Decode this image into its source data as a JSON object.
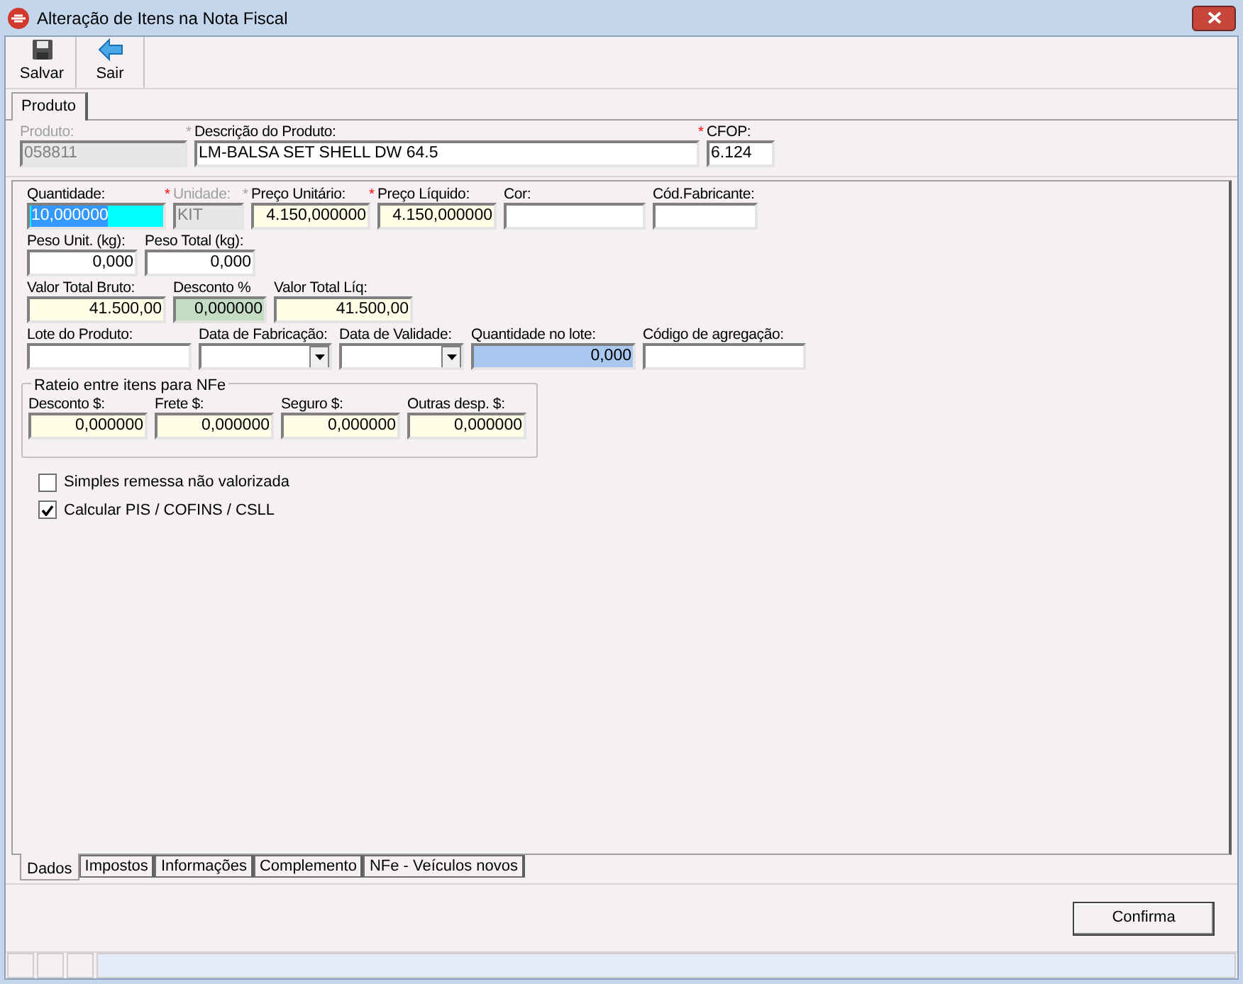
{
  "window": {
    "title": "Alteração de Itens na Nota Fiscal"
  },
  "toolbar": [
    {
      "label": "Salvar",
      "kind": "save"
    },
    {
      "label": "Sair",
      "kind": "exit"
    }
  ],
  "top_tabs": [
    {
      "label": "Produto",
      "selected": true
    }
  ],
  "header_fields": [
    {
      "label": "Produto:",
      "value": "058811",
      "kind": "text",
      "color": "#e9e6e9",
      "disabled": true
    },
    {
      "label": "Descrição do Produto:",
      "value": "LM-BALSA SET SHELL DW 64.5",
      "kind": "text",
      "color": "#ffffff",
      "marker": {
        "text": "*",
        "color": "#a0a0a0"
      }
    },
    {
      "label": "CFOP:",
      "value": "6.124",
      "kind": "text",
      "color": "#ffffff",
      "marker": {
        "text": "*",
        "color": "#ff0000"
      }
    }
  ],
  "field_rows": [
    [
      {
        "label": "Quantidade:",
        "value": "10,000000",
        "kind": "text",
        "color": "#00ffff",
        "focused": true
      },
      {
        "label": "Unidade:",
        "value": "KIT",
        "kind": "text",
        "color": "#e9e6e9",
        "disabled": true,
        "marker": {
          "text": "*",
          "color": "#ff0000"
        }
      },
      {
        "label": "Preço Unitário:",
        "value": "4.150,000000",
        "kind": "number",
        "color": "#ffffe8",
        "marker": {
          "text": "*",
          "color": "#a0a0a0"
        }
      },
      {
        "label": "Preço Líquido:",
        "value": "4.150,000000",
        "kind": "number",
        "color": "#ffffe8",
        "marker": {
          "text": "*",
          "color": "#ff0000"
        }
      },
      {
        "label": "Cor:",
        "kind": "text",
        "color": "#ffffff"
      },
      {
        "label": "Cód.Fabricante:",
        "kind": "text",
        "color": "#ffffff"
      }
    ],
    [
      {
        "label": "Peso Unit. (kg):",
        "value": "0,000",
        "kind": "number",
        "color": "#ffffff"
      },
      {
        "label": "Peso Total (kg):",
        "value": "0,000",
        "kind": "number",
        "color": "#ffffff"
      }
    ],
    [
      {
        "label": "Valor Total Bruto:",
        "value": "41.500,00",
        "kind": "number",
        "color": "#ffffe8"
      },
      {
        "label": "Desconto %",
        "value": "0,000000",
        "kind": "number",
        "color": "#c4dcc4"
      },
      {
        "label": "Valor Total Líq:",
        "value": "41.500,00",
        "kind": "number",
        "color": "#ffffe8"
      }
    ],
    [
      {
        "label": "Lote do Produto:",
        "kind": "text",
        "color": "#ffffff"
      },
      {
        "label": "Data de Fabricação:",
        "kind": "date",
        "color": "#ffffff"
      },
      {
        "label": "Data de Validade:",
        "kind": "date",
        "color": "#ffffff"
      },
      {
        "label": "Quantidade no lote:",
        "value": "0,000",
        "kind": "number",
        "color": "#a8c8f0"
      },
      {
        "label": "Código de agregação:",
        "kind": "text",
        "color": "#ffffff"
      }
    ]
  ],
  "rateio": {
    "title": "Rateio entre itens para NFe",
    "fields": [
      {
        "label": "Desconto $:",
        "value": "0,000000",
        "kind": "number",
        "color": "#ffffe8"
      },
      {
        "label": "Frete $:",
        "value": "0,000000",
        "kind": "number",
        "color": "#ffffe8"
      },
      {
        "label": "Seguro $:",
        "value": "0,000000",
        "kind": "number",
        "color": "#ffffe8"
      },
      {
        "label": "Outras desp. $:",
        "value": "0,000000",
        "kind": "number",
        "color": "#ffffe8"
      }
    ]
  },
  "checkboxes": [
    {
      "label": "Simples remessa não valorizada",
      "checked": false
    },
    {
      "label": "Calcular PIS / COFINS / CSLL",
      "checked": true
    }
  ],
  "bottom_tabs": [
    {
      "label": "Dados",
      "selected": true
    },
    {
      "label": "Impostos",
      "selected": false
    },
    {
      "label": "Informações",
      "selected": false
    },
    {
      "label": "Complemento",
      "selected": false
    },
    {
      "label": "NFe - Veículos novos",
      "selected": false
    }
  ],
  "confirm_button": {
    "label": "Confirma"
  }
}
